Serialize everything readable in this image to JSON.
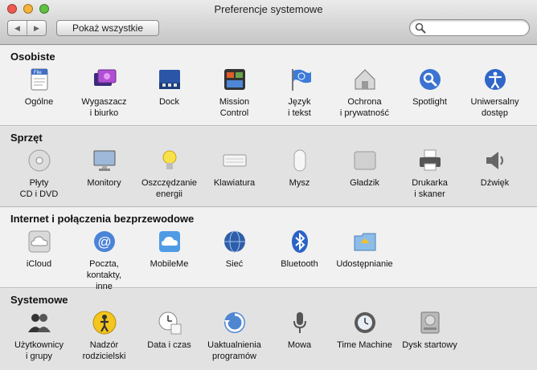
{
  "window": {
    "title": "Preferencje systemowe",
    "traffic_lights": {
      "close": "#ee5a52",
      "minimize": "#f6b33a",
      "zoom": "#5ec142"
    }
  },
  "toolbar": {
    "back_glyph": "◀",
    "forward_glyph": "▶",
    "show_all_label": "Pokaż wszystkie",
    "search_value": ""
  },
  "sections": [
    {
      "title": "Osobiste",
      "items": [
        {
          "label": "Ogólne",
          "icon": "general-icon"
        },
        {
          "label": "Wygaszacz\ni biurko",
          "icon": "desktop-screensaver-icon"
        },
        {
          "label": "Dock",
          "icon": "dock-icon"
        },
        {
          "label": "Mission\nControl",
          "icon": "mission-control-icon"
        },
        {
          "label": "Język\ni tekst",
          "icon": "language-flag-icon"
        },
        {
          "label": "Ochrona\ni prywatność",
          "icon": "security-house-icon"
        },
        {
          "label": "Spotlight",
          "icon": "spotlight-icon"
        },
        {
          "label": "Uniwersalny\ndostęp",
          "icon": "accessibility-icon"
        }
      ]
    },
    {
      "title": "Sprzęt",
      "items": [
        {
          "label": "Płyty\nCD i DVD",
          "icon": "cd-dvd-icon"
        },
        {
          "label": "Monitory",
          "icon": "monitor-icon"
        },
        {
          "label": "Oszczędzanie\nenergii",
          "icon": "lightbulb-icon"
        },
        {
          "label": "Klawiatura",
          "icon": "keyboard-icon"
        },
        {
          "label": "Mysz",
          "icon": "mouse-icon"
        },
        {
          "label": "Gładzik",
          "icon": "trackpad-icon"
        },
        {
          "label": "Drukarka\ni skaner",
          "icon": "printer-icon"
        },
        {
          "label": "Dźwięk",
          "icon": "speaker-icon"
        }
      ]
    },
    {
      "title": "Internet i połączenia bezprzewodowe",
      "items": [
        {
          "label": "iCloud",
          "icon": "icloud-icon"
        },
        {
          "label": "Poczta, kontakty,\ninne",
          "icon": "mail-at-icon"
        },
        {
          "label": "MobileMe",
          "icon": "mobileme-cloud-icon"
        },
        {
          "label": "Sieć",
          "icon": "network-globe-icon"
        },
        {
          "label": "Bluetooth",
          "icon": "bluetooth-icon"
        },
        {
          "label": "Udostępnianie",
          "icon": "sharing-folder-icon"
        }
      ]
    },
    {
      "title": "Systemowe",
      "items": [
        {
          "label": "Użytkownicy\ni grupy",
          "icon": "users-groups-icon"
        },
        {
          "label": "Nadzór\nrodzicielski",
          "icon": "parental-controls-icon"
        },
        {
          "label": "Data i czas",
          "icon": "date-time-clock-icon"
        },
        {
          "label": "Uaktualnienia\nprogramów",
          "icon": "software-update-icon"
        },
        {
          "label": "Mowa",
          "icon": "microphone-icon"
        },
        {
          "label": "Time Machine",
          "icon": "time-machine-icon"
        },
        {
          "label": "Dysk startowy",
          "icon": "startup-disk-icon"
        }
      ]
    }
  ]
}
